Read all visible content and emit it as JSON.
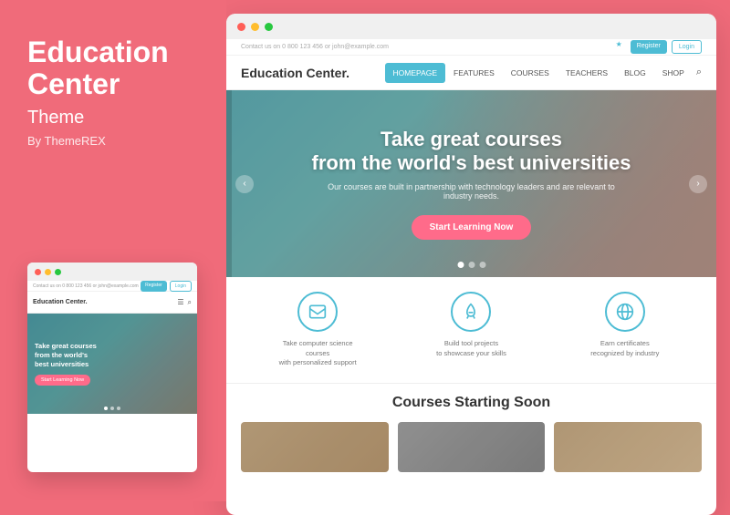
{
  "left": {
    "title_line1": "Education",
    "title_line2": "Center",
    "subtitle": "Theme",
    "author": "By ThemeREX"
  },
  "browser": {
    "dots": [
      "red",
      "yellow",
      "green"
    ]
  },
  "site": {
    "topbar_contact": "Contact us on 0 800 123 456  or john@example.com",
    "topbar_register": "Register",
    "topbar_login": "Login",
    "logo": "Education Center.",
    "nav_items": [
      {
        "label": "HOMEPAGE",
        "active": true
      },
      {
        "label": "FEATURES",
        "active": false
      },
      {
        "label": "COURSES",
        "active": false
      },
      {
        "label": "TEACHERS",
        "active": false
      },
      {
        "label": "BLOG",
        "active": false
      },
      {
        "label": "SHOP",
        "active": false
      }
    ],
    "hero": {
      "headline_line1": "Take great courses",
      "headline_line2": "from the world's best universities",
      "subtext": "Our courses are built in partnership with technology leaders and are relevant to industry needs.",
      "cta_label": "Start Learning Now",
      "carousel_dots": [
        true,
        false,
        false
      ]
    },
    "features": [
      {
        "icon": "✉",
        "text_line1": "Take computer science courses",
        "text_line2": "with personalized support"
      },
      {
        "icon": "🚀",
        "text_line1": "Build tool projects",
        "text_line2": "to showcase your skills"
      },
      {
        "icon": "🌐",
        "text_line1": "Earn certificates",
        "text_line2": "recognized by industry"
      }
    ],
    "courses_section": {
      "title": "Courses Starting Soon",
      "cards": [
        {
          "color": "#c4a882"
        },
        {
          "color": "#a0a0a0"
        },
        {
          "color": "#c4a882"
        }
      ]
    }
  },
  "mini": {
    "contact": "Contact us on 0 800 123 456  or john@example.com",
    "logo": "Education Center.",
    "hero_text_line1": "Take great courses",
    "hero_text_line2": "from the world's",
    "hero_text_line3": "best universities",
    "cta_label": "Start Learning Now",
    "register": "Register",
    "login": "Login"
  },
  "colors": {
    "brand_pink": "#f06b7a",
    "brand_teal": "#4dbcd4",
    "hero_cta": "#ff6b8a",
    "white": "#ffffff"
  }
}
